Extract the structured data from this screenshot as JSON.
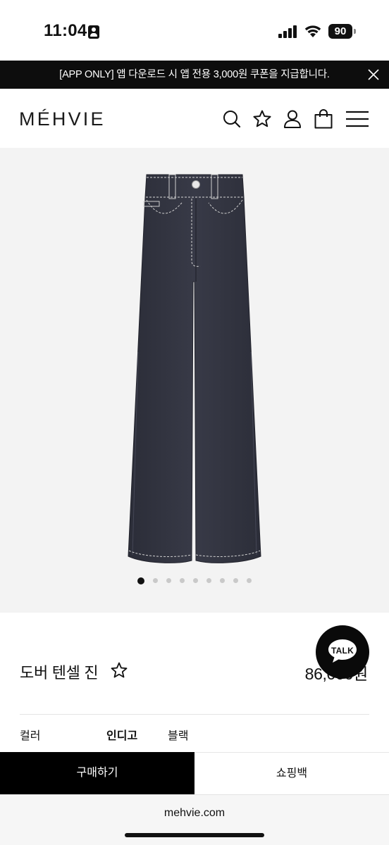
{
  "status_bar": {
    "time": "11:04",
    "battery": "90"
  },
  "promo": {
    "text": "[APP ONLY] 앱 다운로드 시 앱 전용 3,000원 쿠폰을 지급합니다."
  },
  "header": {
    "logo": "MÉHVIE",
    "icons": [
      "search-icon",
      "star-icon",
      "user-icon",
      "shopping-bag-icon",
      "menu-icon"
    ]
  },
  "gallery": {
    "image_count": 9,
    "active_index": 0
  },
  "product": {
    "name": "도버 텐셀 진",
    "price": "86,000원",
    "color_label": "컬러",
    "colors": [
      {
        "label": "인디고",
        "selected": true
      },
      {
        "label": "블랙",
        "selected": false
      }
    ]
  },
  "chat": {
    "label": "TALK"
  },
  "actions": {
    "buy_label": "구매하기",
    "bag_label": "쇼핑백"
  },
  "browser": {
    "url": "mehvie.com"
  }
}
